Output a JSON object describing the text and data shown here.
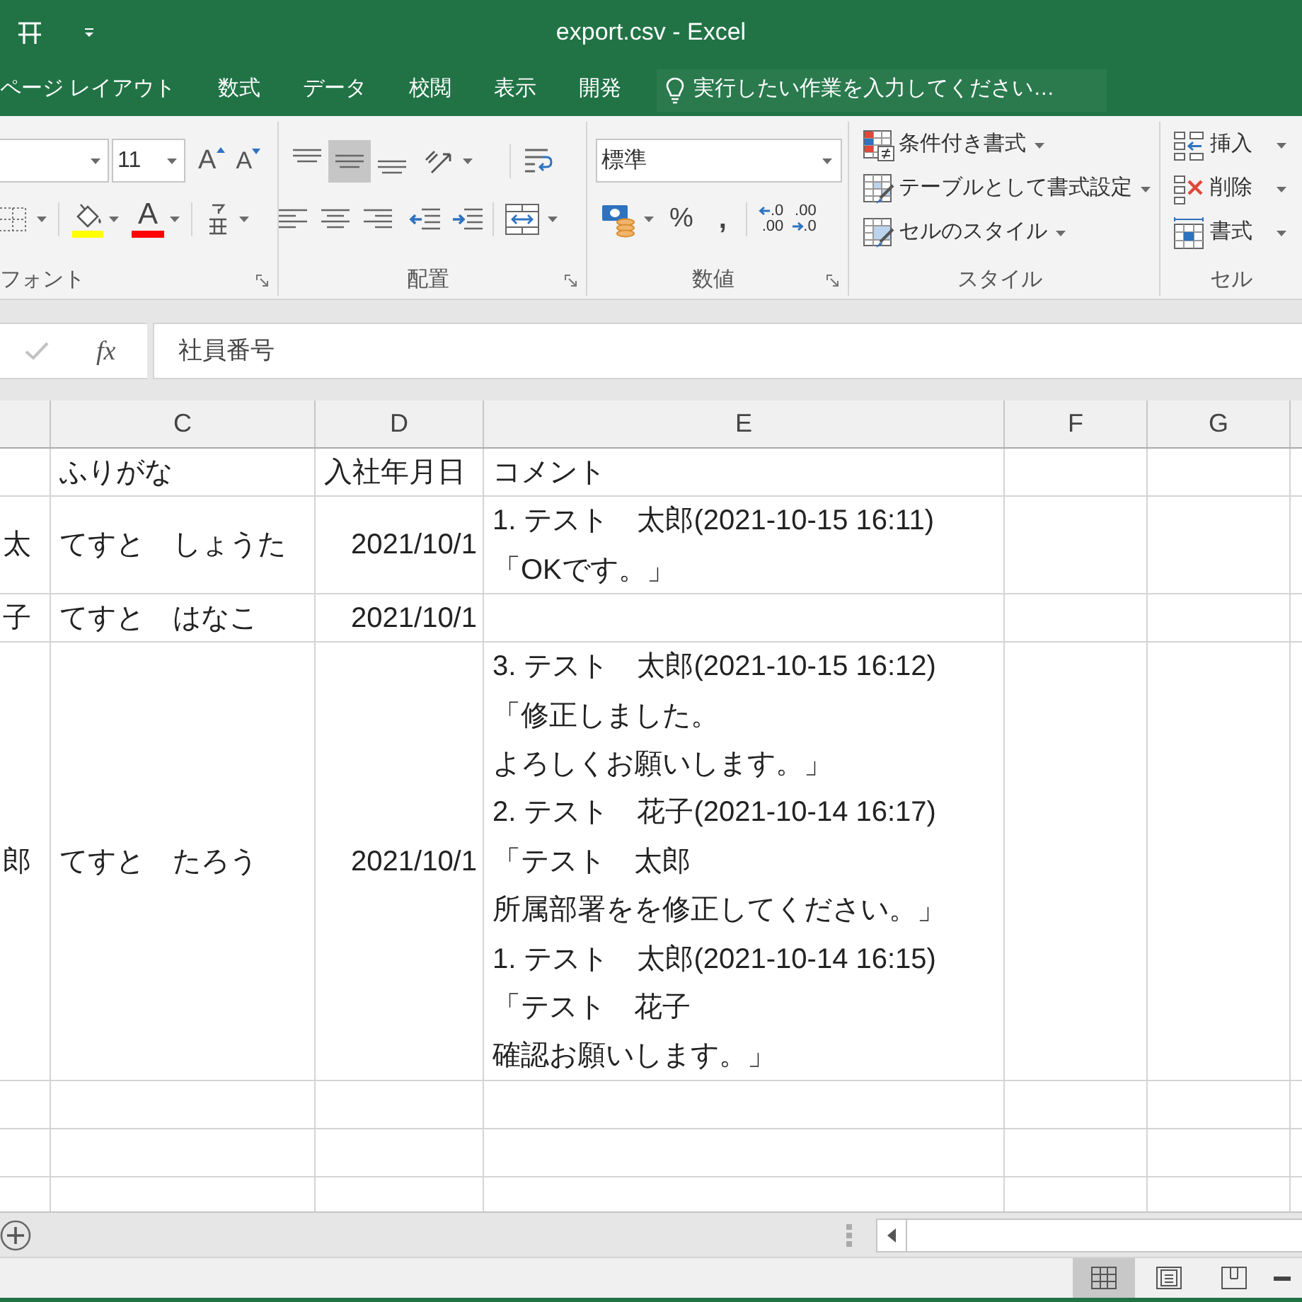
{
  "window": {
    "title": "export.csv - Excel"
  },
  "ribbon_tabs": [
    {
      "label": "ページ レイアウト",
      "selected": false
    },
    {
      "label": "数式",
      "selected": false
    },
    {
      "label": "データ",
      "selected": false
    },
    {
      "label": "校閲",
      "selected": false
    },
    {
      "label": "表示",
      "selected": false
    },
    {
      "label": "開発",
      "selected": false
    }
  ],
  "tell_me": {
    "placeholder": "実行したい作業を入力してください…"
  },
  "ribbon": {
    "font": {
      "label": "フォント",
      "size": "11",
      "grow_button": "A",
      "shrink_button": "A",
      "color_button": "A"
    },
    "alignment": {
      "label": "配置",
      "vertical_align": [
        {
          "kind": "top",
          "selected": false
        },
        {
          "kind": "middle",
          "selected": true
        },
        {
          "kind": "bottom",
          "selected": false
        }
      ]
    },
    "number": {
      "label": "数値",
      "format": "標準",
      "percent_button": "%",
      "comma_button": ",",
      "decimal_buttons": [
        {
          "kind": "increase",
          "lines": [
            ".0",
            ".00"
          ]
        },
        {
          "kind": "decrease",
          "lines": [
            ".00",
            ".0"
          ]
        }
      ]
    },
    "styles": {
      "label": "スタイル",
      "items": [
        {
          "kind": "conditional",
          "label": "条件付き書式"
        },
        {
          "kind": "table",
          "label": "テーブルとして書式設定"
        },
        {
          "kind": "cell_style",
          "label": "セルのスタイル"
        }
      ]
    },
    "cells": {
      "label": "セル",
      "items": [
        {
          "kind": "insert",
          "label": "挿入"
        },
        {
          "kind": "delete",
          "label": "削除"
        },
        {
          "kind": "format",
          "label": "書式"
        }
      ]
    }
  },
  "formula_bar": {
    "function_button": "fx",
    "value": "社員番号"
  },
  "sheet": {
    "columns": [
      {
        "label": "C"
      },
      {
        "label": "D"
      },
      {
        "label": "E"
      },
      {
        "label": "F"
      },
      {
        "label": "G"
      }
    ],
    "rows": [
      {
        "kind": "header",
        "c": "ふりがな",
        "d": "入社年月日",
        "e": [
          "コメント"
        ]
      },
      {
        "kind": "record",
        "b": "太",
        "c": "てすと　しょうた",
        "d": "2021/10/1",
        "e": [
          "1. テスト　太郎(2021-10-15 16:11)",
          "「OKです。」"
        ]
      },
      {
        "kind": "record",
        "b": "子",
        "c": "てすと　はなこ",
        "d": "2021/10/1"
      },
      {
        "kind": "record",
        "b": "郎",
        "c": "てすと　たろう",
        "d": "2021/10/1",
        "e": [
          "3. テスト　太郎(2021-10-15 16:12)",
          "「修正しました。",
          "よろしくお願いします。」",
          "2. テスト　花子(2021-10-14 16:17)",
          "「テスト　太郎",
          "所属部署をを修正してください。」",
          "1. テスト　太郎(2021-10-14 16:15)",
          "「テスト　花子",
          "確認お願いします。」"
        ]
      }
    ]
  },
  "status_bar": {
    "view_buttons": [
      {
        "kind": "normal",
        "selected": true
      },
      {
        "kind": "page_layout",
        "selected": false
      },
      {
        "kind": "page_break",
        "selected": false
      }
    ]
  }
}
